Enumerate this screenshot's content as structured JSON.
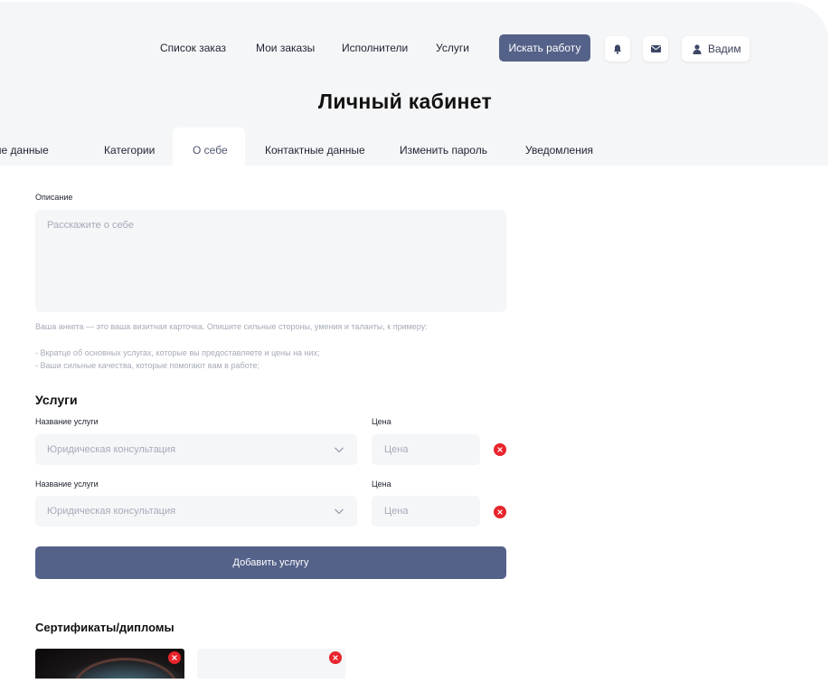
{
  "nav": {
    "links": [
      "Список заказ",
      "Мои заказы",
      "Исполнители",
      "Услуги"
    ],
    "search_button": "Искать работу",
    "user_name": "Вадим"
  },
  "page": {
    "title": "Личный кабинет"
  },
  "tabs": [
    "ьные данные",
    "Категории",
    "О себе",
    "Контактные данные",
    "Изменить пароль",
    "Уведомления"
  ],
  "active_tab": "О себе",
  "description": {
    "label": "Описание",
    "placeholder": "Расскажите о себе",
    "hint_line1": "Ваша анкета — это ваша визитная карточка. Опишите сильные стороны, умения и таланты, к примеру:",
    "hint_line2": "- Вкратце об основных услугах, которые вы предоставляете и цены на них;",
    "hint_line3": "- Ваши сильные качества, которые помогают вам в работе;"
  },
  "services": {
    "title": "Услуги",
    "rows": [
      {
        "name_label": "Название услуги",
        "name_value": "Юридическая консультация",
        "price_label": "Цена",
        "price_placeholder": "Цена"
      },
      {
        "name_label": "Название услуги",
        "name_value": "Юридическая консультация",
        "price_label": "Цена",
        "price_placeholder": "Цена"
      }
    ],
    "add_button": "Добавить услугу"
  },
  "certificates": {
    "title": "Сертификаты/дипломы"
  },
  "colors": {
    "accent": "#546189",
    "danger": "#e8242c",
    "field_bg": "#f5f6f8",
    "frame_bg": "#eceef2"
  }
}
